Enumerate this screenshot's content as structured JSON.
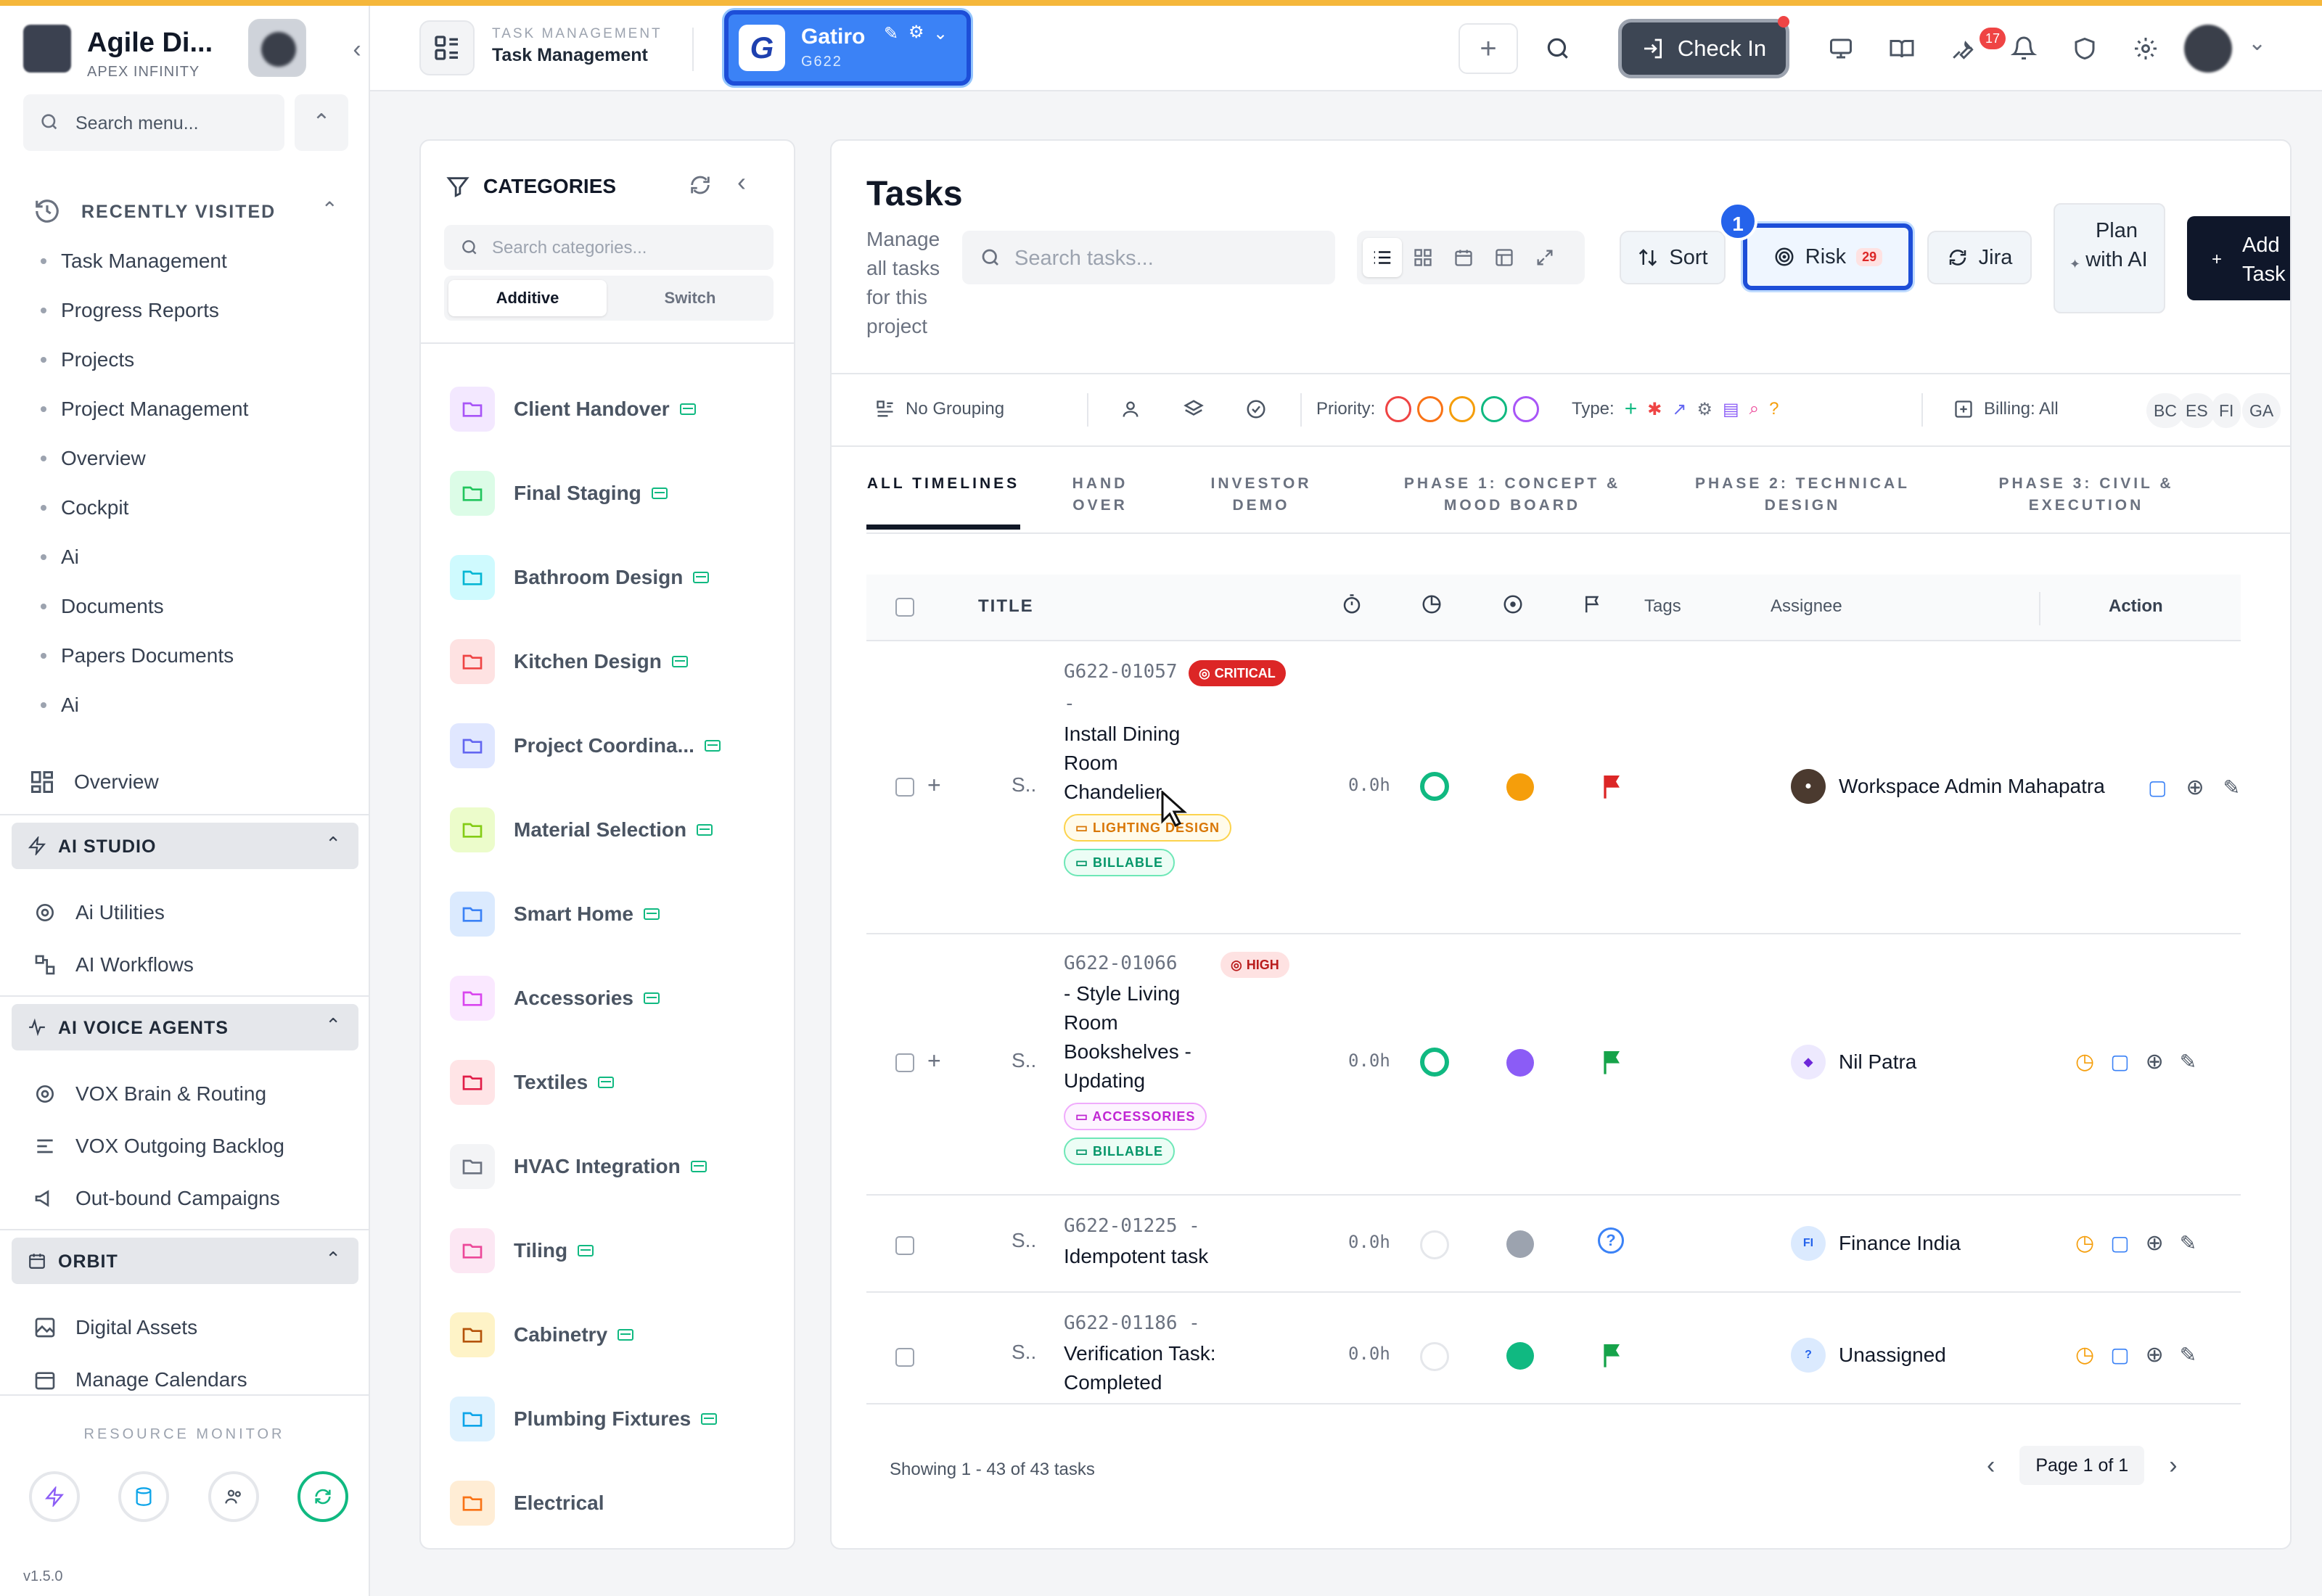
{
  "brand": {
    "name": "Agile Di...",
    "subtitle": "APEX INFINITY"
  },
  "sidebar": {
    "search_placeholder": "Search menu...",
    "recently_visited": {
      "label": "RECENTLY VISITED",
      "items": [
        "Task Management",
        "Progress Reports",
        "Projects",
        "Project Management",
        "Overview",
        "Cockpit",
        "Ai",
        "Documents",
        "Papers Documents",
        "Ai"
      ]
    },
    "overview": "Overview",
    "ai_studio": {
      "label": "AI STUDIO",
      "items": [
        "Ai Utilities",
        "AI Workflows"
      ]
    },
    "ai_voice": {
      "label": "AI VOICE AGENTS",
      "items": [
        "VOX Brain & Routing",
        "VOX Outgoing Backlog",
        "Out-bound Campaigns"
      ]
    },
    "orbit": {
      "label": "ORBIT",
      "items": [
        "Digital Assets",
        "Manage Calendars"
      ]
    },
    "resource_monitor": "RESOURCE MONITOR",
    "version": "v1.5.0"
  },
  "header": {
    "module_small": "TASK MANAGEMENT",
    "module_big": "Task Management",
    "project_name": "Gatiro",
    "project_code": "G622",
    "project_logo": "G",
    "checkin_label": "Check In",
    "notif_count": "17"
  },
  "categories": {
    "title": "CATEGORIES",
    "search_placeholder": "Search categories...",
    "modes": [
      "Additive",
      "Switch"
    ],
    "items": [
      {
        "name": "Client Handover",
        "color": "#a855f7",
        "bg": "#f3e8ff"
      },
      {
        "name": "Final Staging",
        "color": "#22c55e",
        "bg": "#dcfce7"
      },
      {
        "name": "Bathroom Design",
        "color": "#06b6d4",
        "bg": "#cffafe"
      },
      {
        "name": "Kitchen Design",
        "color": "#ef4444",
        "bg": "#fee2e2"
      },
      {
        "name": "Project Coordina...",
        "color": "#6366f1",
        "bg": "#e0e7ff"
      },
      {
        "name": "Material Selection",
        "color": "#84cc16",
        "bg": "#ecfccb"
      },
      {
        "name": "Smart Home",
        "color": "#3b82f6",
        "bg": "#dbeafe"
      },
      {
        "name": "Accessories",
        "color": "#d946ef",
        "bg": "#fae8ff"
      },
      {
        "name": "Textiles",
        "color": "#e11d48",
        "bg": "#ffe4e6"
      },
      {
        "name": "HVAC Integration",
        "color": "#6b7280",
        "bg": "#f3f4f6"
      },
      {
        "name": "Tiling",
        "color": "#ec4899",
        "bg": "#fce7f3"
      },
      {
        "name": "Cabinetry",
        "color": "#b45309",
        "bg": "#fef3c7"
      },
      {
        "name": "Plumbing Fixtures",
        "color": "#0ea5e9",
        "bg": "#e0f2fe"
      },
      {
        "name": "Electrical",
        "color": "#f97316",
        "bg": "#ffedd5"
      }
    ]
  },
  "tasks": {
    "title": "Tasks",
    "subtitle": "Manage all tasks for this project",
    "search_placeholder": "Search tasks...",
    "sort_label": "Sort",
    "risk_label": "Risk",
    "risk_count": "29",
    "step_number": "1",
    "jira_label": "Jira",
    "plan_label": "Plan with AI",
    "add_label": "Add Task"
  },
  "filters": {
    "grouping": "No Grouping",
    "priority_label": "Priority:",
    "type_label": "Type:",
    "billing": "Billing: All",
    "chips": [
      "BC",
      "ES",
      "FI",
      "GA"
    ]
  },
  "tabs": [
    {
      "label": "ALL TIMELINES"
    },
    {
      "label": "HAND OVER"
    },
    {
      "label": "INVESTOR DEMO"
    },
    {
      "label": "PHASE 1: CONCEPT & MOOD BOARD"
    },
    {
      "label": "PHASE 2: TECHNICAL DESIGN"
    },
    {
      "label": "PHASE 3: CIVIL & EXECUTION"
    }
  ],
  "table": {
    "headers": {
      "title": "TITLE",
      "tags": "Tags",
      "assignee": "Assignee",
      "action": "Action"
    },
    "rows": [
      {
        "code": "G622-01057 -",
        "title": "Install Dining Room Chandelier",
        "priority": "CRITICAL",
        "category_tag": "LIGHTING DESIGN",
        "billing_tag": "BILLABLE",
        "hours": "0.0h",
        "assignee": "Workspace Admin Mahapatra",
        "status_color": "#10b981",
        "dot_color": "#f59e0b",
        "flag_color": "#dc2626",
        "s": "S.."
      },
      {
        "code": "G622-01066",
        "title": "- Style Living Room Bookshelves - Updating",
        "priority": "HIGH",
        "category_tag": "ACCESSORIES",
        "billing_tag": "BILLABLE",
        "hours": "0.0h",
        "assignee": "Nil Patra",
        "status_color": "#10b981",
        "dot_color": "#8b5cf6",
        "flag_color": "#16a34a",
        "s": "S.."
      },
      {
        "code": "G622-01225 -",
        "title": "Idempotent task",
        "hours": "0.0h",
        "assignee": "Finance India",
        "assignee_initials": "FI",
        "dot_color": "#9ca3af",
        "s": "S.."
      },
      {
        "code": "G622-01186 -",
        "title": "Verification Task: Completed",
        "hours": "0.0h",
        "assignee": "Unassigned",
        "assignee_initials": "?",
        "dot_color": "#10b981",
        "flag_color": "#16a34a",
        "s": "S.."
      }
    ]
  },
  "footer": {
    "showing": "Showing 1 - 43 of 43 tasks",
    "page": "Page 1 of 1"
  }
}
